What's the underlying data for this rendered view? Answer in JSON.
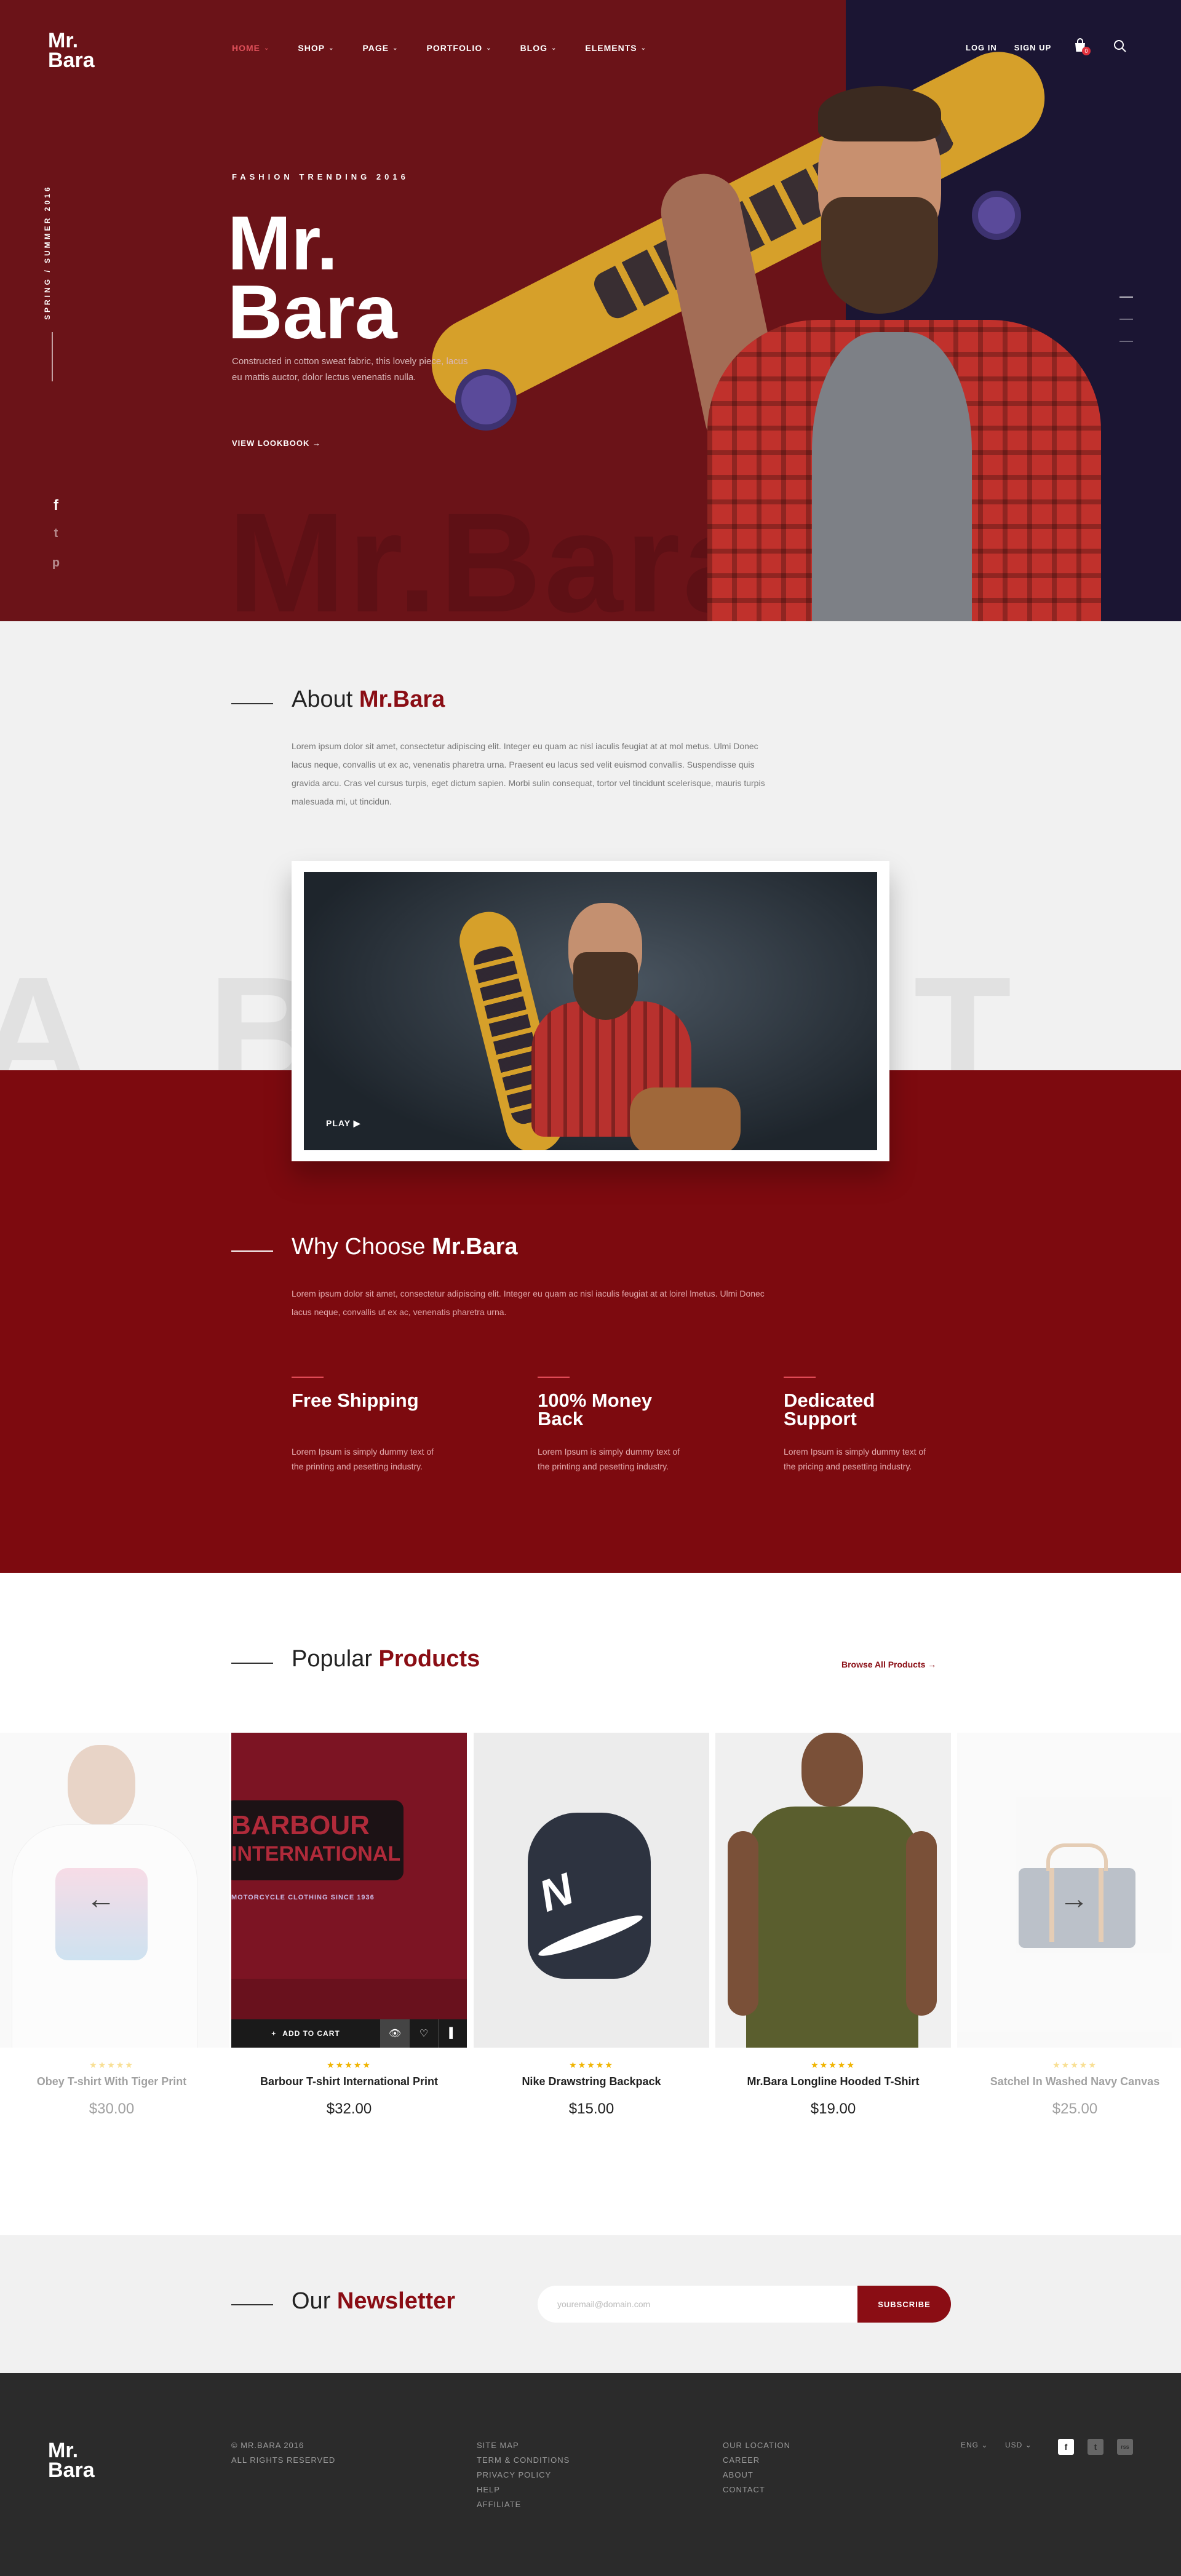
{
  "brand": {
    "logo_line1": "Mr.",
    "logo_line2": "Bara"
  },
  "nav": {
    "items": [
      {
        "label": "HOME",
        "active": true
      },
      {
        "label": "SHOP"
      },
      {
        "label": "PAGE"
      },
      {
        "label": "PORTFOLIO"
      },
      {
        "label": "BLOG"
      },
      {
        "label": "ELEMENTS"
      }
    ],
    "login": "LOG IN",
    "signup": "SIGN UP",
    "cart_count": "0"
  },
  "hero": {
    "side_text": "SPRING / SUMMER 2016",
    "eyebrow": "FASHION TRENDING 2016",
    "title_line1": "Mr.",
    "title_line2": "Bara",
    "text": "Constructed in cotton sweat fabric, this lovely piece, lacus eu mattis auctor, dolor lectus venenatis nulla.",
    "cta": "VIEW LOOKBOOK",
    "ghost": "Mr.Bara",
    "social": [
      "f",
      "t",
      "p"
    ]
  },
  "about": {
    "title_plain": "About ",
    "title_bold": "Mr.Bara",
    "text": "Lorem ipsum dolor sit amet, consectetur adipiscing elit. Integer eu quam ac nisl iaculis feugiat at at mol metus. Ulmi Donec lacus neque, convallis ut ex ac, venenatis pharetra urna. Praesent eu lacus sed velit euismod convallis. Suspendisse quis gravida arcu. Cras vel cursus turpis, eget dictum sapien. Morbi sulin consequat, tortor vel tincidunt scelerisque, mauris turpis malesuada mi, ut tincidun.",
    "ghost": "ABOUT",
    "play": "PLAY"
  },
  "why": {
    "title_plain": "Why Choose ",
    "title_bold": "Mr.Bara",
    "text": "Lorem ipsum dolor sit amet, consectetur adipiscing elit. Integer eu quam ac nisl iaculis feugiat at at loirel lmetus. Ulmi Donec lacus neque, convallis ut ex ac, venenatis pharetra urna.",
    "features": [
      {
        "title": "Free Shipping",
        "text": "Lorem Ipsum is simply dummy text of the printing and pesetting industry."
      },
      {
        "title": "100% Money Back",
        "text": "Lorem Ipsum is simply dummy text of the printing and pesetting industry."
      },
      {
        "title": "Dedicated Support",
        "text": "Lorem Ipsum is simply dummy text of the pricing and pesetting industry."
      }
    ]
  },
  "products": {
    "title_plain": "Popular ",
    "title_bold": "Products",
    "browse": "Browse All Products",
    "add_to_cart": "ADD TO CART",
    "items": [
      {
        "name": "Obey T-shirt With Tiger Print",
        "price": "$30.00",
        "rating": 5
      },
      {
        "name": "Barbour T-shirt International Print",
        "price": "$32.00",
        "rating": 5
      },
      {
        "name": "Nike Drawstring Backpack",
        "price": "$15.00",
        "rating": 5
      },
      {
        "name": "Mr.Bara Longline Hooded T-Shirt",
        "price": "$19.00",
        "rating": 5
      },
      {
        "name": "Satchel In Washed Navy Canvas",
        "price": "$25.00",
        "rating": 5
      }
    ],
    "barbour_line1": "BARBOUR",
    "barbour_line2": "INTERNATIONAL",
    "barbour_line3": "MOTORCYCLE CLOTHING SINCE 1936"
  },
  "newsletter": {
    "title_plain": "Our ",
    "title_bold": "Newsletter",
    "placeholder": "youremail@domain.com",
    "button": "SUBSCRIBE"
  },
  "footer": {
    "copyright": "© MR.BARA 2016",
    "rights": "ALL RIGHTS RESERVED",
    "links1": [
      "SITE MAP",
      "TERM & CONDITIONS",
      "PRIVACY POLICY",
      "HELP",
      "AFFILIATE"
    ],
    "links2": [
      "OUR LOCATION",
      "CAREER",
      "ABOUT",
      "CONTACT"
    ],
    "language": "ENG",
    "currency": "USD",
    "social": [
      "f",
      "t",
      "rss"
    ]
  },
  "colors": {
    "brand_red": "#8a0d14",
    "hero_red": "#6b1318",
    "hero_navy": "#1b1533",
    "footer": "#2b2b2b",
    "star": "#f0b400"
  }
}
